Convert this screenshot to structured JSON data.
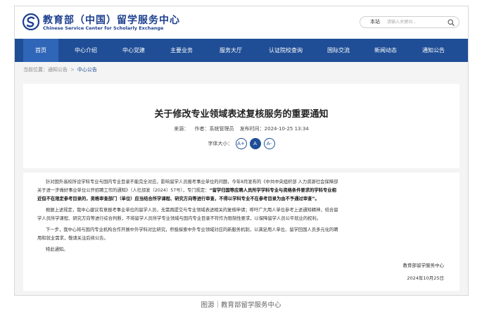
{
  "header": {
    "logo_cn": "教育部（中国）留学服务中心",
    "logo_en": "Chinese Service Center for Scholarly Exchange",
    "search": {
      "scope": "本站",
      "placeholder": "请输入关键词..."
    }
  },
  "nav": {
    "items": [
      {
        "label": "首页",
        "active": true
      },
      {
        "label": "中心介绍"
      },
      {
        "label": "中心党建"
      },
      {
        "label": "主要业务"
      },
      {
        "label": "服务大厅"
      },
      {
        "label": "认证院校查询"
      },
      {
        "label": "国际交流"
      },
      {
        "label": "新闻动态"
      },
      {
        "label": "通知公告"
      }
    ]
  },
  "breadcrumb": {
    "prefix": "当前位置：通知公告",
    "separator": ">",
    "current": "中心公告"
  },
  "article": {
    "title": "关于修改专业领域表述复核服务的重要通知",
    "source_label": "来源：",
    "author": "作者：系统管理员",
    "published": "发布时间：2024-10-25 13:34",
    "font_size_label": "字体大小：",
    "font_buttons": [
      "A+",
      "A",
      "A-"
    ],
    "paragraphs": [
      {
        "line1": "针对国外高校所设学科专业与国内专业目录不能完全对应，影响留学人员报考事业单位的问题，今年8月发布的《中共中央组织部 人力资源社会保障部",
        "line2a": "关于进一步做好事业单位公开招聘工作的通知》（人社部发〔2024〕57号），专门规定：",
        "line2b": "“留学归国等应聘人员所学学科专业与资格条件要求的学科专业相",
        "line3": "近但不在限定参考目录的，资格审查部门（单位）应当结合所学课程、研究方向等进行审查，不得以学科专业不在参考目录为由不予通过审查”。"
      },
      {
        "line1": "根据上述规定，我中心建议有意报考事业单位的留学人员，无需再提交与专业领域表述相关的复核申请；呼吁广大用人单位参考上述通知精神，结合留",
        "line2": "学人员所学课程、研究方向等进行综合判断，不将留学人员所学专业领域与国内专业目录不符作为限制性要求，以保障留学人员公平就业的权利。"
      },
      {
        "line1": "下一步，我中心将与国内专业机构合作开展中外学科对比研究，积极探索中外专业领域对应的新服务机制，以满足用人单位、留学回国人员多元化的聘",
        "line2": "用和就业需求，敬请关注后续公告。"
      },
      {
        "line1": "特此通知。"
      }
    ],
    "signature_org": "教育部留学服务中心",
    "signature_date": "2024年10月25日"
  },
  "caption": "图源｜教育部留学服务中心",
  "colors": {
    "nav_bg": "#1f4e96",
    "nav_active": "#2f66b8",
    "brand": "#1d3f8f"
  }
}
